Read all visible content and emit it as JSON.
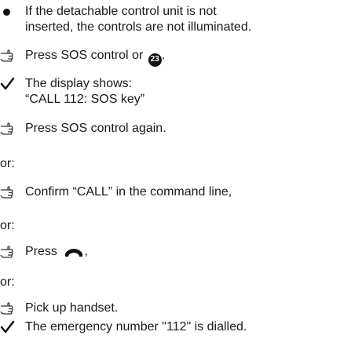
{
  "items": [
    {
      "type": "bullet",
      "lines": [
        "If the detachable control unit is not",
        "inserted, the controls are not illuminated."
      ]
    },
    {
      "type": "action",
      "text_before": "Press SOS control or ",
      "badge": "23",
      "text_after": "."
    },
    {
      "type": "result",
      "lines": [
        "The display shows:",
        "“CALL 112: SOS key”"
      ]
    },
    {
      "type": "action",
      "text": "Press SOS control again."
    },
    {
      "type": "plain",
      "text": "or:"
    },
    {
      "type": "action",
      "text": "Confirm “CALL” in the command line,"
    },
    {
      "type": "plain",
      "text": "or:"
    },
    {
      "type": "action",
      "text_before": "Press ",
      "icon": "handset-icon",
      "text_after": ","
    },
    {
      "type": "plain",
      "text": "or:"
    },
    {
      "type": "action",
      "text": "Pick up handset."
    },
    {
      "type": "result",
      "lines": [
        "The emergency number \"112\" is dialled."
      ]
    }
  ]
}
